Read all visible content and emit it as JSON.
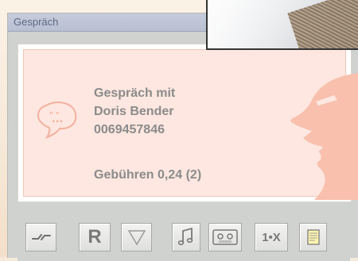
{
  "window": {
    "title": "Gespräch"
  },
  "call": {
    "heading": "Gespräch mit",
    "contact_name": "Doris Bender",
    "phone_number": "0069457846",
    "fees": "Gebühren 0,24 (2)"
  },
  "toolbar": {
    "buttons": [
      {
        "name": "hangup-button",
        "icon": "broken-line-icon",
        "label": ""
      },
      {
        "name": "r-button",
        "icon": "",
        "label": "R"
      },
      {
        "name": "conference-button",
        "icon": "triangle-outline-icon",
        "label": ""
      },
      {
        "name": "music-button",
        "icon": "music-note-icon",
        "label": ""
      },
      {
        "name": "tape-button",
        "icon": "cassette-icon",
        "label": ""
      },
      {
        "name": "transfer-button",
        "icon": "",
        "label": "1•X"
      },
      {
        "name": "notes-button",
        "icon": "notepad-icon",
        "label": ""
      }
    ]
  },
  "colors": {
    "accent_pink": "#fde7e0",
    "face_pink": "#f8c0ad",
    "window_gray": "#cfd2cf",
    "title_bar": "#c2c8d8"
  }
}
